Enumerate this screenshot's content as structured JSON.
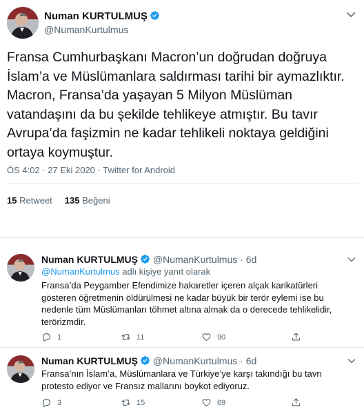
{
  "main": {
    "author_name": "Numan KURTULMUŞ",
    "author_handle": "@NumanKurtulmus",
    "text": "Fransa Cumhurbaşkanı Macron’un doğrudan doğruya İslam’a ve Müslümanlara saldırması tarihi bir aymazlıktır. Macron, Fransa’da yaşayan 5 Milyon Müslüman vatandaşını da bu şekilde tehlikeye atmıştır. Bu tavır Avrupa’da faşizmin ne kadar tehlikeli noktaya geldiğini ortaya koymuştur.",
    "timestamp": "ÖS 4:02 · 27 Eki 2020 · Twitter for Android",
    "retweet_count": "15",
    "retweet_label": "Retweet",
    "like_count": "135",
    "like_label": "Beğeni"
  },
  "replies": [
    {
      "author_name": "Numan KURTULMUŞ",
      "author_handle": "@NumanKurtulmus",
      "time": "· 6d",
      "replying_mention": "@NumanKurtulmus",
      "replying_suffix": " adlı kişiye yanıt olarak",
      "text": "Fransa’da Peygamber Efendimize hakaretler içeren alçak karikatürleri gösteren öğretmenin öldürülmesi ne kadar büyük bir terör eylemi ise bu nedenle tüm Müslümanları töhmet altına almak da o derecede tehlikelidir, terörizmdir.",
      "reply_count": "1",
      "retweet_count": "11",
      "like_count": "90"
    },
    {
      "author_name": "Numan KURTULMUŞ",
      "author_handle": "@NumanKurtulmus",
      "time": "· 6d",
      "text": "Fransa’nın İslam’a, Müslümanlara ve Türkiye’ye karşı takındığı bu tavrı protesto ediyor ve Fransız mallarını boykot ediyoruz.",
      "reply_count": "3",
      "retweet_count": "15",
      "like_count": "69"
    }
  ],
  "colors": {
    "accent": "#1d9bf0",
    "text_secondary": "#536471",
    "divider": "#e1e8ed"
  },
  "icons": [
    "verified-badge-icon",
    "chevron-down-icon",
    "reply-icon",
    "retweet-icon",
    "like-icon",
    "share-icon"
  ]
}
